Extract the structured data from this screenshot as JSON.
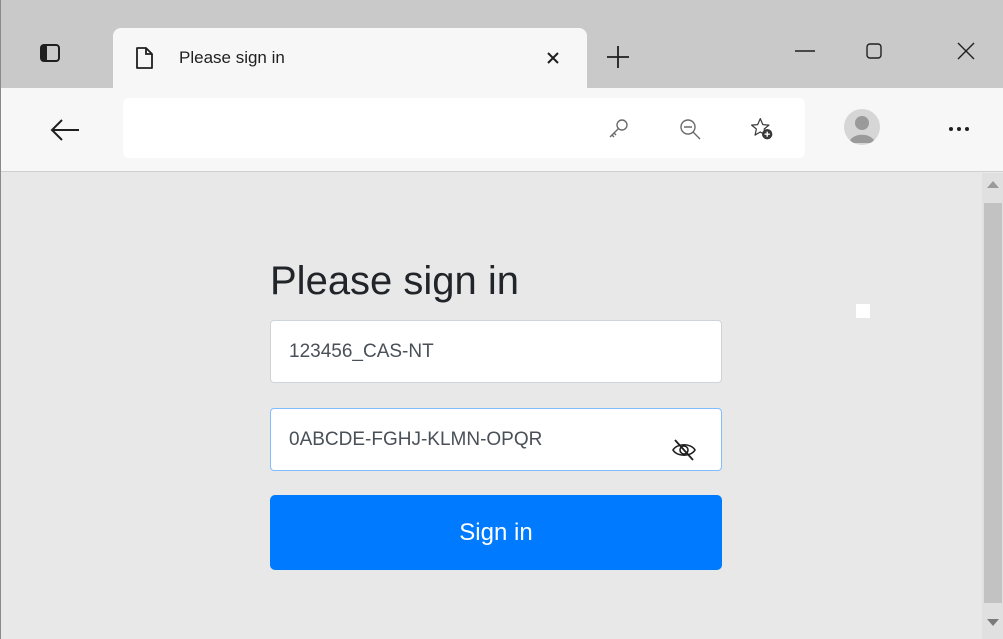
{
  "tab": {
    "title": "Please sign in"
  },
  "page": {
    "heading": "Please sign in",
    "username_value": "123456_CAS-NT",
    "password_value": "0ABCDE-FGHJ-KLMN-OPQR",
    "signin_label": "Sign in"
  },
  "icons": {
    "tab_actions": "tab-actions-icon",
    "favicon": "page-icon",
    "close_tab": "close-icon",
    "new_tab": "plus-icon",
    "minimize": "minimize-icon",
    "maximize": "maximize-icon",
    "close_window": "close-icon",
    "back": "back-arrow-icon",
    "password_key": "key-icon",
    "zoom_out": "zoom-out-icon",
    "favorites": "add-favorite-icon",
    "profile": "profile-avatar",
    "more": "more-icon",
    "reveal_password": "eye-off-icon"
  },
  "colors": {
    "primary_button": "#007bff",
    "page_background": "#e8e8e8",
    "focused_border": "#80bdff"
  }
}
